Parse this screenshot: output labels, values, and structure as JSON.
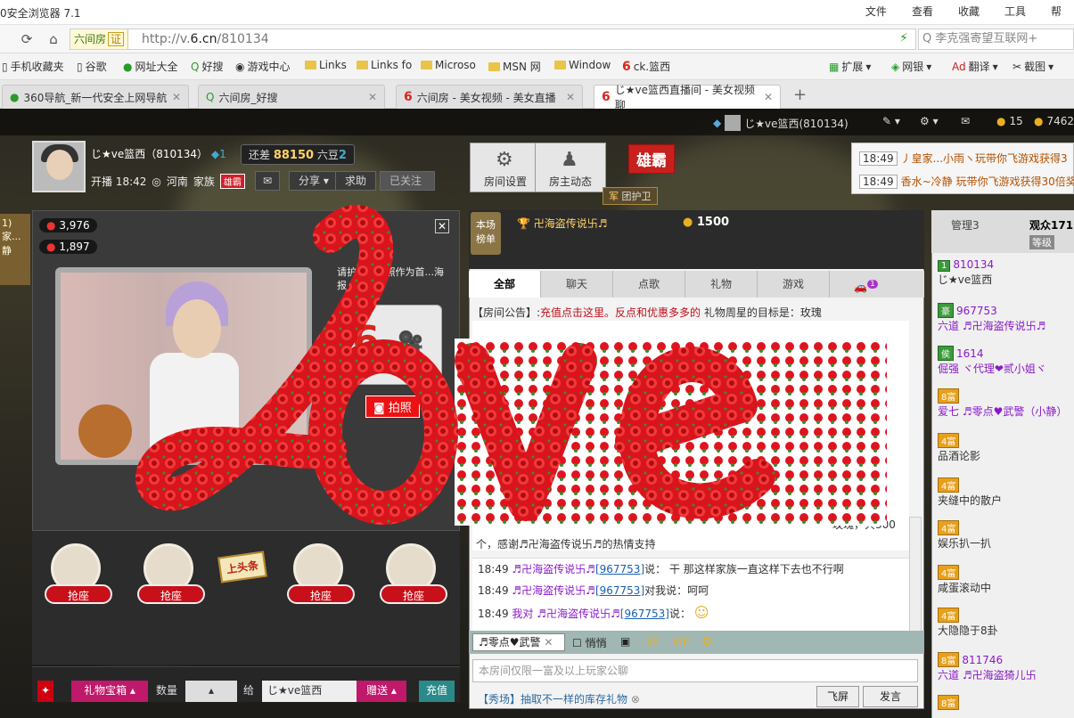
{
  "browser": {
    "title": "0安全浏览器 7.1",
    "menu": [
      "文件",
      "查看",
      "收藏",
      "工具",
      "帮"
    ],
    "address": {
      "site_label": "六间房",
      "site_badge": "证",
      "url_prefix": "http://v.",
      "url_domain": "6.cn",
      "url_path": "/810134",
      "search_placeholder": "Q 李克强寄望互联网+"
    },
    "bookmarks": [
      "手机收藏夹",
      "谷歌",
      "网址大全",
      "好搜",
      "游戏中心",
      "Links",
      "Links fo",
      "Microso",
      "MSN 网",
      "Window",
      "ck.篮西"
    ],
    "bookmark_tools": [
      "扩展",
      "网银",
      "翻译",
      "截图"
    ],
    "tabs": [
      {
        "label": "360导航_新一代安全上网导航",
        "icon": "360-icon"
      },
      {
        "label": "六间房_好搜",
        "icon": "search-icon"
      },
      {
        "label": "六间房 - 美女视频 - 美女直播",
        "icon": "six-icon"
      },
      {
        "label": "じ★ve篮西直播间 - 美女视频聊",
        "icon": "six-icon"
      }
    ]
  },
  "top_strip": {
    "user": "じ★ve篮西(810134)",
    "coins": "15",
    "beans": "7462"
  },
  "anchor": {
    "name": "じ★ve篮西（810134）",
    "level": "1",
    "start_time": "开播 18:42",
    "location": "河南",
    "family_label": "家族",
    "family_badge": "雄霸",
    "gap_prefix": "还差",
    "gap_value": "88150",
    "gap_suffix": "六豆",
    "gap_level": "2",
    "actions": {
      "share": "分享",
      "help": "求助",
      "followed": "已关注"
    }
  },
  "buttons": {
    "room_settings": "房间设置",
    "host_updates": "房主动态",
    "xiongba": "雄霸",
    "guard": "团护卫"
  },
  "ticker": [
    {
      "time": "18:49",
      "text": "丿皇家...小雨ヽ玩带你飞游戏获得3"
    },
    {
      "time": "18:49",
      "text": "香水~冷静 玩带你飞游戏获得30倍奖"
    }
  ],
  "left_panel": {
    "side_tab": "1)\n家...静",
    "wealth_count": "3,976",
    "fan_count": "1,897",
    "promo_text": "请护...视频照作为首...海报",
    "photo_button": "拍照",
    "seats": [
      "抢座",
      "抢座",
      "抢座",
      "抢座"
    ],
    "headline": "上头条"
  },
  "gift_bar": {
    "gift_box": "礼物宝箱",
    "quantity_label": "数量",
    "to_label": "给",
    "recipient": "じ★ve篮西",
    "send": "赠送",
    "recharge": "充值"
  },
  "chat": {
    "rank_label": "本场\n榜单",
    "top_user": "卍海盗传说卐♬",
    "top_score": "1500",
    "tabs": [
      "全部",
      "聊天",
      "点歌",
      "礼物",
      "游戏"
    ],
    "car_badge": "1",
    "notice_label": "【房间公告】:",
    "notice_text": "充值点击这里。反点和优惠多多的",
    "notice_target": "礼物周星的目标是：玫瑰",
    "rose_summary": "玫瑰，共300",
    "rose_thanks": "个，感谢♬卍海盗传说卐♬的热情支持",
    "messages": [
      {
        "time": "18:49",
        "from": "♬卍海盗传说卐♬",
        "id": "[967753]",
        "verb": "说：",
        "text": "干 那这样家族一直这样下去也不行啊"
      },
      {
        "time": "18:49",
        "from": "♬卍海盗传说卐♬",
        "id": "[967753]",
        "verb": "对我说：",
        "text": "呵呵"
      },
      {
        "time": "18:49",
        "from": "我对 ♬卍海盗传说卐♬",
        "id": "[967753]",
        "verb": "说：",
        "text": "☺"
      }
    ],
    "target_user": "♬零点♥武警",
    "private_label": "悄悄",
    "input_placeholder": "本房间仅限一富及以上玩家公聊",
    "promo": "【秀场】抽取不一样的库存礼物",
    "fly_button": "飞屏",
    "send_button": "发言"
  },
  "right_panel": {
    "tab_admin": "管理3",
    "tab_audience": "观众171",
    "sort_label": "等级",
    "users": [
      {
        "badge": "1",
        "id": "810134",
        "name": "じ★ve篮西"
      },
      {
        "badge": "豪",
        "id": "967753",
        "name": "六道 ♬卍海盗传说卐♬"
      },
      {
        "badge": "侯",
        "id": "1614",
        "name": "倔强 ヾ代理❤贰小姐ヾ"
      },
      {
        "badge": "8富",
        "id": "",
        "name": "爱七 ♬零点♥武警（小静）"
      },
      {
        "badge": "4富",
        "id": "",
        "name": "品酒论影"
      },
      {
        "badge": "4富",
        "id": "",
        "name": "夹缝中的散户"
      },
      {
        "badge": "4富",
        "id": "",
        "name": "娱乐扒一扒"
      },
      {
        "badge": "4富",
        "id": "",
        "name": "咸蛋滚动中"
      },
      {
        "badge": "4富",
        "id": "",
        "name": "大隐隐于8卦"
      },
      {
        "badge": "8富",
        "id": "811746",
        "name": "六道 ♬卍海盗猗儿卐"
      },
      {
        "badge": "8富",
        "id": "",
        "name": ""
      }
    ]
  },
  "overlay": {
    "word": "Love"
  },
  "colors": {
    "accent_red": "#d8261d",
    "rose": "#e0141e",
    "leaf": "#3b8a2e"
  }
}
